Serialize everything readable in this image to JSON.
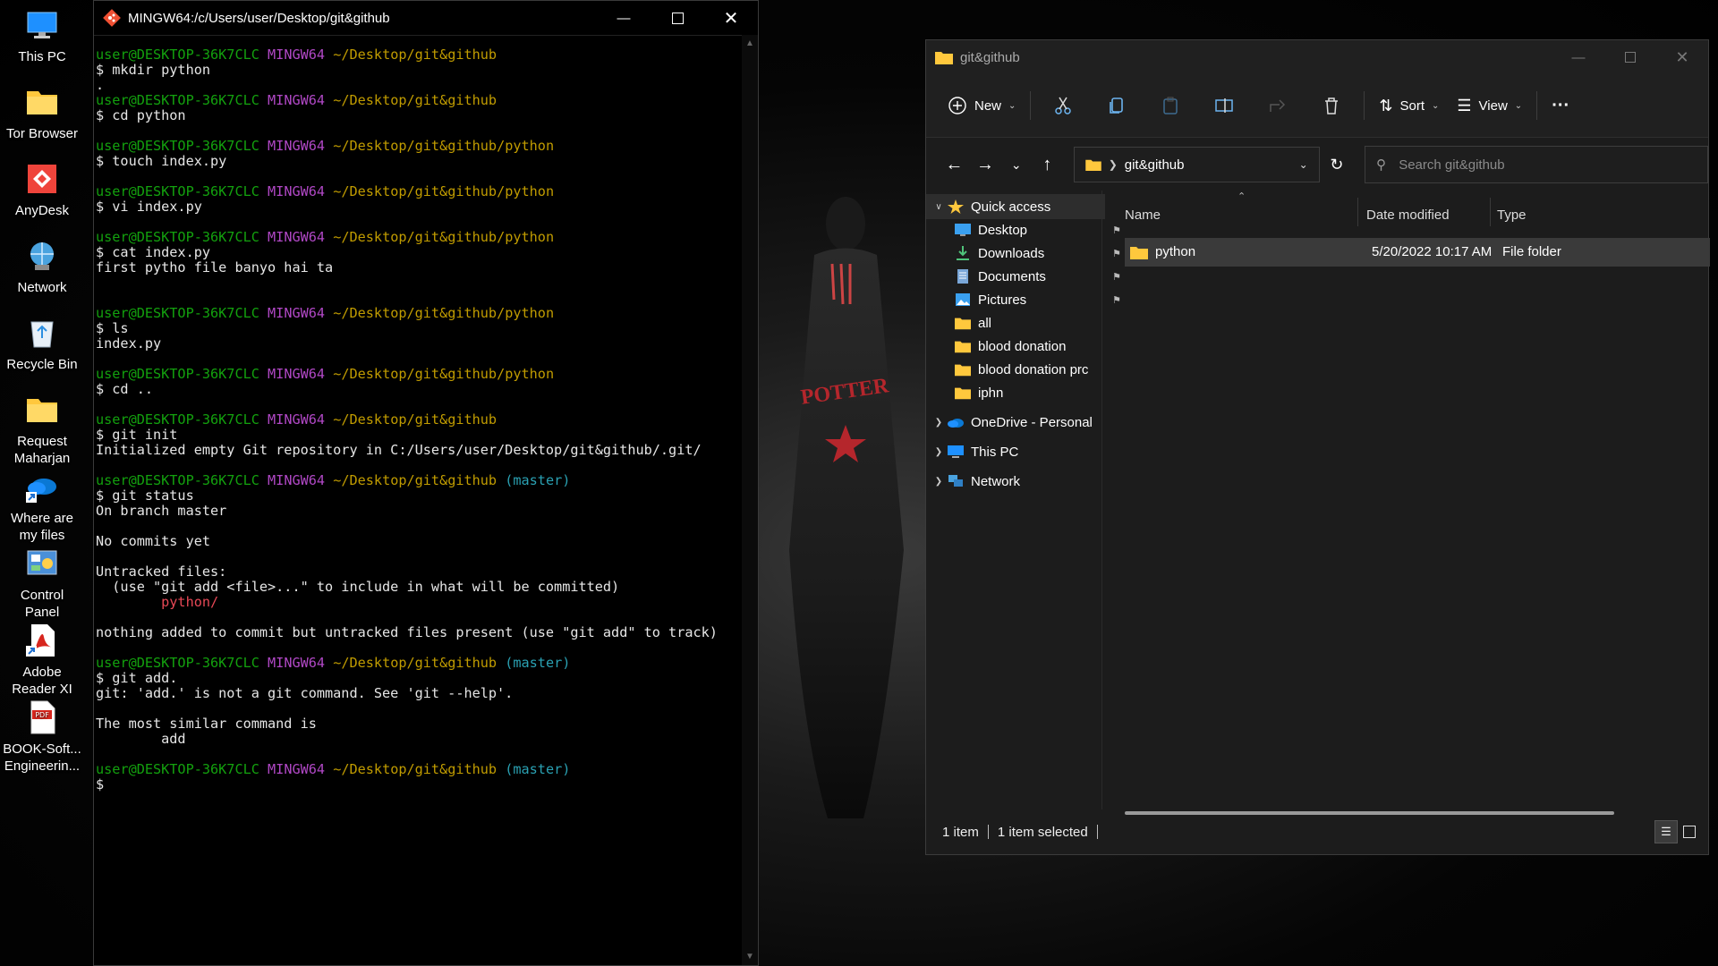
{
  "desktop": {
    "icons": [
      {
        "label": "This PC",
        "icon": "monitor-icon"
      },
      {
        "label": "Tor Browser",
        "icon": "folder-icon"
      },
      {
        "label": "AnyDesk",
        "icon": "anydesk-icon"
      },
      {
        "label": "Network",
        "icon": "network-icon"
      },
      {
        "label": "Recycle Bin",
        "icon": "recycle-bin-icon"
      },
      {
        "label": "Request Maharjan",
        "icon": "folder-icon"
      },
      {
        "label": "Where are my files",
        "icon": "onedrive-shortcut-icon"
      },
      {
        "label": "Control Panel",
        "icon": "control-panel-icon"
      },
      {
        "label": "Adobe Reader XI",
        "icon": "adobe-reader-icon"
      },
      {
        "label": "BOOK-Soft... Engineerin...",
        "icon": "pdf-icon"
      }
    ],
    "wallpaper_text": "POTTER"
  },
  "terminal": {
    "title": "MINGW64:/c/Users/user/Desktop/git&github",
    "prompt": {
      "user": "user@DESKTOP-36K7CLC",
      "host": "MINGW64"
    },
    "blocks": [
      {
        "path": "~/Desktop/git&github",
        "branch": "",
        "cmd": "$ mkdir python",
        "output": [
          "."
        ]
      },
      {
        "path": "~/Desktop/git&github",
        "branch": "",
        "cmd": "$ cd python",
        "output": [
          ""
        ]
      },
      {
        "path": "~/Desktop/git&github/python",
        "branch": "",
        "cmd": "$ touch index.py",
        "output": [
          ""
        ]
      },
      {
        "path": "~/Desktop/git&github/python",
        "branch": "",
        "cmd": "$ vi index.py",
        "output": [
          ""
        ]
      },
      {
        "path": "~/Desktop/git&github/python",
        "branch": "",
        "cmd": "$ cat index.py",
        "output": [
          "first pytho file banyo hai ta",
          "",
          ""
        ]
      },
      {
        "path": "~/Desktop/git&github/python",
        "branch": "",
        "cmd": "$ ls",
        "output": [
          "index.py",
          ""
        ]
      },
      {
        "path": "~/Desktop/git&github/python",
        "branch": "",
        "cmd": "$ cd ..",
        "output": [
          ""
        ]
      },
      {
        "path": "~/Desktop/git&github",
        "branch": "",
        "cmd": "$ git init",
        "output": [
          "Initialized empty Git repository in C:/Users/user/Desktop/git&github/.git/",
          ""
        ]
      },
      {
        "path": "~/Desktop/git&github",
        "branch": "(master)",
        "cmd": "$ git status",
        "output": [
          "On branch master",
          "",
          "No commits yet",
          "",
          "Untracked files:",
          "  (use \"git add <file>...\" to include in what will be committed)",
          "RED:        python/",
          "",
          "nothing added to commit but untracked files present (use \"git add\" to track)",
          ""
        ]
      },
      {
        "path": "~/Desktop/git&github",
        "branch": "(master)",
        "cmd": "$ git add.",
        "output": [
          "git: 'add.' is not a git command. See 'git --help'.",
          "",
          "The most similar command is",
          "        add",
          ""
        ]
      },
      {
        "path": "~/Desktop/git&github",
        "branch": "(master)",
        "cmd": "$",
        "output": []
      }
    ]
  },
  "explorer": {
    "title": "git&github",
    "toolbar": {
      "new": "New",
      "sort": "Sort",
      "view": "View"
    },
    "address": {
      "crumb": "git&github"
    },
    "search": {
      "placeholder": "Search git&github"
    },
    "sidebar": [
      {
        "label": "Quick access",
        "icon": "star-icon",
        "expand": "v",
        "pinned": false,
        "level": 0
      },
      {
        "label": "Desktop",
        "icon": "desktop-icon",
        "expand": "",
        "pinned": true,
        "level": 1
      },
      {
        "label": "Downloads",
        "icon": "download-icon",
        "expand": "",
        "pinned": true,
        "level": 1
      },
      {
        "label": "Documents",
        "icon": "documents-icon",
        "expand": "",
        "pinned": true,
        "level": 1
      },
      {
        "label": "Pictures",
        "icon": "pictures-icon",
        "expand": "",
        "pinned": true,
        "level": 1
      },
      {
        "label": "all",
        "icon": "folder-icon",
        "expand": "",
        "pinned": false,
        "level": 1
      },
      {
        "label": "blood donation",
        "icon": "folder-icon",
        "expand": "",
        "pinned": false,
        "level": 1
      },
      {
        "label": "blood donation prc",
        "icon": "folder-icon",
        "expand": "",
        "pinned": false,
        "level": 1
      },
      {
        "label": "iphn",
        "icon": "folder-icon",
        "expand": "",
        "pinned": false,
        "level": 1
      },
      {
        "label": "OneDrive - Personal",
        "icon": "onedrive-icon",
        "expand": ">",
        "pinned": false,
        "level": 0
      },
      {
        "label": "This PC",
        "icon": "monitor-icon",
        "expand": ">",
        "pinned": false,
        "level": 0
      },
      {
        "label": "Network",
        "icon": "network-icon",
        "expand": ">",
        "pinned": false,
        "level": 0
      }
    ],
    "columns": [
      "Name",
      "Date modified",
      "Type"
    ],
    "files": [
      {
        "name": "python",
        "date": "5/20/2022 10:17 AM",
        "type": "File folder"
      }
    ],
    "status": {
      "count": "1 item",
      "selected": "1 item selected"
    },
    "colors": {
      "accent": "#ffc83d",
      "selected_row": "#3a3a3a",
      "background": "#1c1c1c"
    }
  }
}
